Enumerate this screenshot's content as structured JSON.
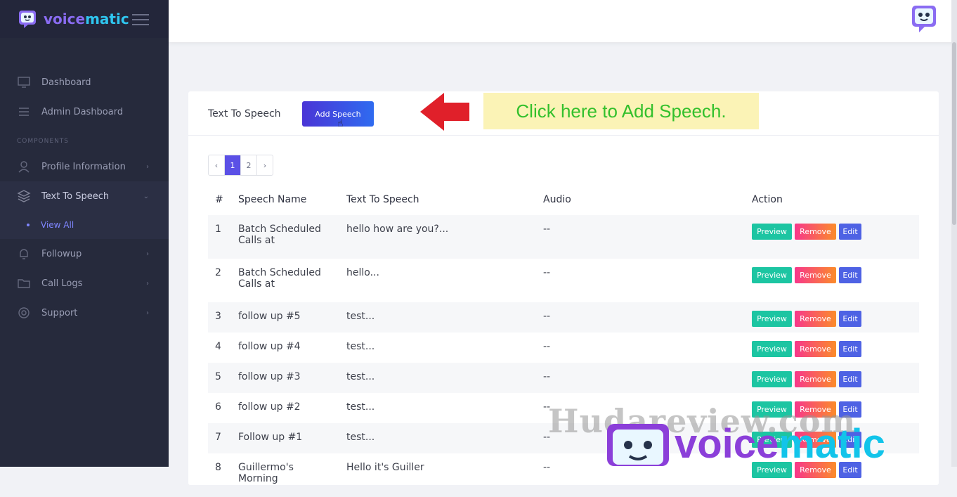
{
  "brand": {
    "part1": "voice",
    "part2": "matic"
  },
  "sidebar": {
    "items": [
      {
        "label": "Dashboard",
        "icon": "monitor-icon"
      },
      {
        "label": "Admin Dashboard",
        "icon": "sliders-icon"
      }
    ],
    "section_label": "COMPONENTS",
    "components": [
      {
        "label": "Profile Information",
        "icon": "user-icon"
      },
      {
        "label": "Text To Speech",
        "icon": "layers-icon"
      }
    ],
    "sub_item": "View All",
    "more": [
      {
        "label": "Followup",
        "icon": "bell-icon"
      },
      {
        "label": "Call Logs",
        "icon": "folder-icon"
      },
      {
        "label": "Support",
        "icon": "support-icon"
      }
    ]
  },
  "card": {
    "title": "Text To Speech",
    "add_button": "Add Speech"
  },
  "callout": "Click here to Add Speech.",
  "pager": {
    "prev": "‹",
    "pages": [
      "1",
      "2"
    ],
    "next": "›",
    "current": "1"
  },
  "table": {
    "headers": [
      "#",
      "Speech Name",
      "Text To Speech",
      "Audio",
      "Action"
    ],
    "rows": [
      {
        "n": "1",
        "name": "Batch Scheduled Calls at",
        "text": "hello how are you?...",
        "audio": "--"
      },
      {
        "n": "2",
        "name": "Batch Scheduled Calls at",
        "text": "hello...",
        "audio": "--"
      },
      {
        "n": "3",
        "name": "follow up #5",
        "text": "test...",
        "audio": "--"
      },
      {
        "n": "4",
        "name": "follow up #4",
        "text": "test...",
        "audio": "--"
      },
      {
        "n": "5",
        "name": "follow up #3",
        "text": "test...",
        "audio": "--"
      },
      {
        "n": "6",
        "name": "follow up #2",
        "text": "test...",
        "audio": "--"
      },
      {
        "n": "7",
        "name": "Follow up #1",
        "text": "test...",
        "audio": "--"
      },
      {
        "n": "8",
        "name": "Guillermo's Morning",
        "text": "Hello it's Guiller",
        "audio": "--"
      }
    ],
    "actions": {
      "preview": "Preview",
      "remove": "Remove",
      "edit": "Edit"
    }
  },
  "watermark": {
    "site": "Hudareview.com",
    "logo_part1": "voice",
    "logo_part2": "matic"
  }
}
